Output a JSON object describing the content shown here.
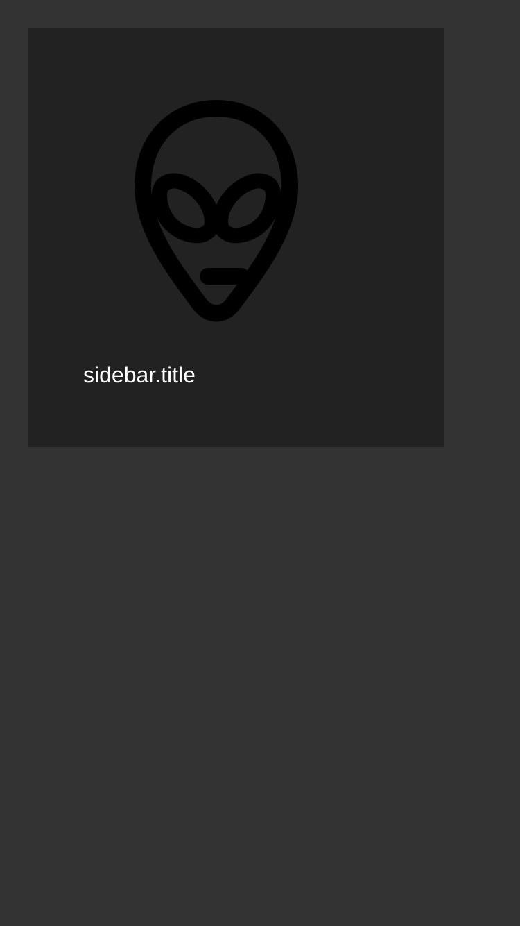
{
  "sidebar": {
    "title": "sidebar.title",
    "icon": "alien-icon"
  },
  "colors": {
    "page_background": "#333333",
    "panel_background": "#222222",
    "icon": "#000000",
    "title_text": "#ffffff"
  }
}
